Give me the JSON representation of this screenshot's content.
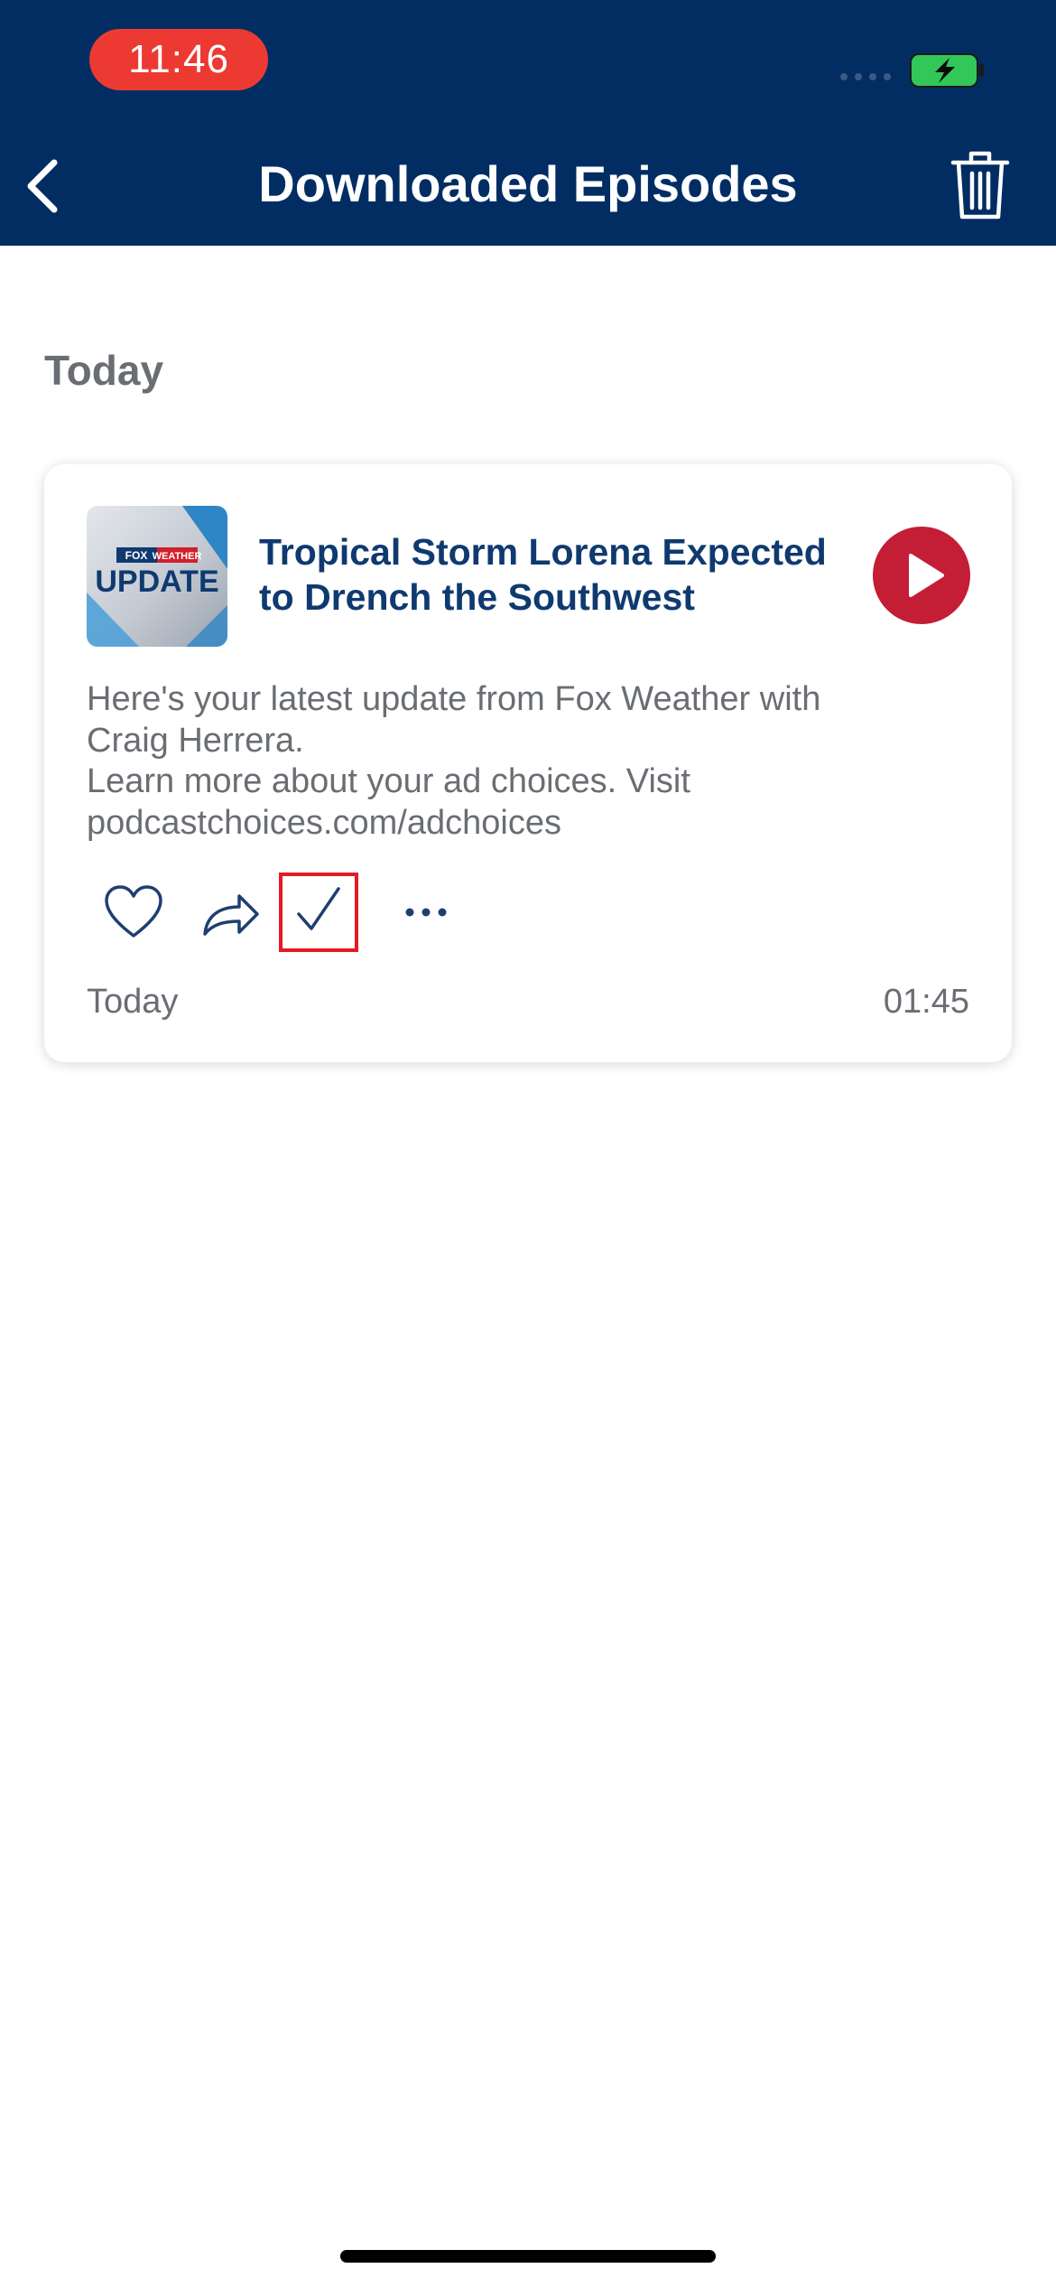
{
  "status_bar": {
    "time": "11:46"
  },
  "header": {
    "title": "Downloaded Episodes"
  },
  "section": {
    "heading": "Today"
  },
  "episode": {
    "artwork_brand": "FOX WEATHER",
    "artwork_label": "UPDATE",
    "title": "Tropical Storm Lorena Expected to Drench the Southwest",
    "description_lines": [
      "Here's your latest update from Fox Weather with",
      "Craig Herrera.",
      "Learn more about your ad choices. Visit",
      "podcastchoices.com/adchoices"
    ],
    "date": "Today",
    "duration": "01:45"
  },
  "colors": {
    "header_bg": "#012d63",
    "title_text": "#0f3a70",
    "play_button": "#c41d36",
    "time_pill": "#ec3a32",
    "battery": "#33c759",
    "highlight_box": "#e31b23"
  },
  "icons": {
    "back": "chevron-left-icon",
    "trash": "trash-icon",
    "play": "play-icon",
    "like": "heart-icon",
    "share": "share-arrow-icon",
    "mark_played": "checkmark-icon",
    "more": "ellipsis-icon"
  }
}
